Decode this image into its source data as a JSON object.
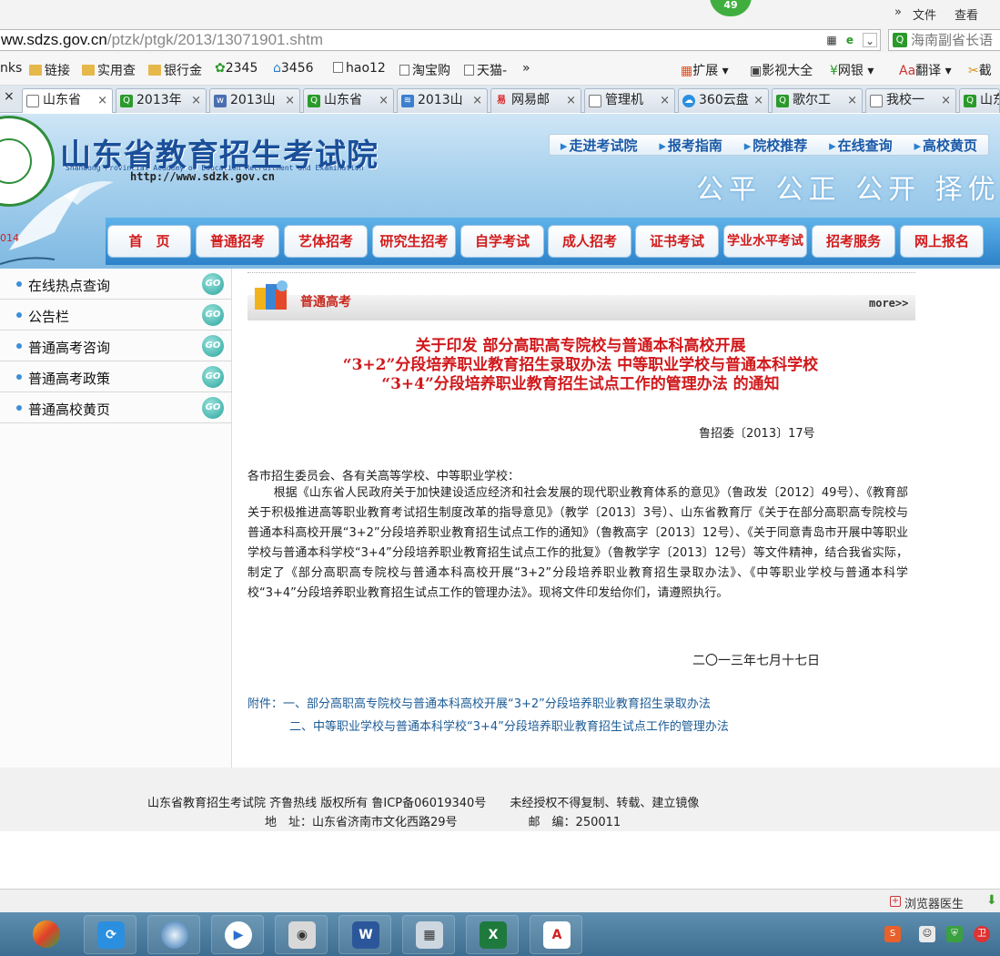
{
  "browser": {
    "badge": "49",
    "menu": {
      "arrows": "»",
      "file": "文件",
      "view": "查看"
    },
    "address": {
      "domain": "ww.sdzs.gov.cn",
      "path": "/ptzk/ptgk/2013/13071901.shtm"
    },
    "search_value": "海南副省长语",
    "bookmarks": [
      "nks",
      "链接",
      "实用查",
      "银行金",
      "2345",
      "3456",
      "hao12",
      "淘宝购",
      "天猫-",
      "»"
    ],
    "bookmarks_right": [
      "扩展",
      "影视大全",
      "网银",
      "翻译",
      "截"
    ],
    "tabs": [
      "山东省",
      "2013年",
      "2013山",
      "山东省",
      "2013山",
      "网易邮",
      "管理机",
      "360云盘",
      "歌尔工",
      "我校一",
      "山东"
    ],
    "tab_close": "×",
    "status_text": "浏览器医生"
  },
  "site": {
    "title": "山东省教育招生考试院",
    "subtitle": "Shandong Provincial Academy of Education Recruitment and Examination",
    "url": "http://www.sdzk.gov.cn",
    "quick_links": [
      "走进考试院",
      "报考指南",
      "院校推荐",
      "在线查询",
      "高校黄页"
    ],
    "motto": "公平 公正 公开 择优",
    "year_mark": "014",
    "nav": [
      "首　页",
      "普通招考",
      "艺体招考",
      "研究生招考",
      "自学考试",
      "成人招考",
      "证书考试",
      "学业水平考试",
      "招考服务",
      "网上报名"
    ]
  },
  "sidebar": {
    "items": [
      "在线热点查询",
      "公告栏",
      "普通高考咨询",
      "普通高考政策",
      "普通高校黄页"
    ],
    "go_label": "GO"
  },
  "content": {
    "section_title": "普通高考",
    "more": "more>>",
    "title_lines": [
      "关于印发 部分高职高专院校与普通本科高校开展",
      "“3+2”分段培养职业教育招生录取办法 中等职业学校与普通本科学校",
      "“3+4”分段培养职业教育招生试点工作的管理办法 的通知"
    ],
    "doc_number": "鲁招委〔2013〕17号",
    "greeting": "各市招生委员会、各有关高等学校、中等职业学校：",
    "body": "根据《山东省人民政府关于加快建设适应经济和社会发展的现代职业教育体系的意见》（鲁政发〔2012〕49号）、《教育部关于积极推进高等职业教育考试招生制度改革的指导意见》（教学〔2013〕3号）、山东省教育厅《关于在部分高职高专院校与普通本科高校开展“3+2”分段培养职业教育招生试点工作的通知》（鲁教高字〔2013〕12号）、《关于同意青岛市开展中等职业学校与普通本科学校“3+4”分段培养职业教育招生试点工作的批复》（鲁教学字〔2013〕12号）等文件精神，结合我省实际，制定了《部分高职高专院校与普通本科高校开展“3+2”分段培养职业教育招生录取办法》、《中等职业学校与普通本科学校“3+4”分段培养职业教育招生试点工作的管理办法》。现将文件印发给你们，请遵照执行。",
    "date": "二〇一三年七月十七日",
    "attachment_1": "附件：一、部分高职高专院校与普通本科高校开展“3+2”分段培养职业教育招生录取办法",
    "attachment_2": "二、中等职业学校与普通本科学校“3+4”分段培养职业教育招生试点工作的管理办法"
  },
  "footer": {
    "line1": "山东省教育招生考试院 齐鲁热线 版权所有 鲁ICP备06019340号　　未经授权不得复制、转载、建立镜像",
    "line2": "地　址：山东省济南市文化西路29号　　　　　　邮　编：250011"
  },
  "colors": {
    "accent_red": "#d0191c",
    "nav_blue": "#2d82c9",
    "link_blue": "#1b5b96",
    "brand_blue": "#1a4f9a"
  }
}
